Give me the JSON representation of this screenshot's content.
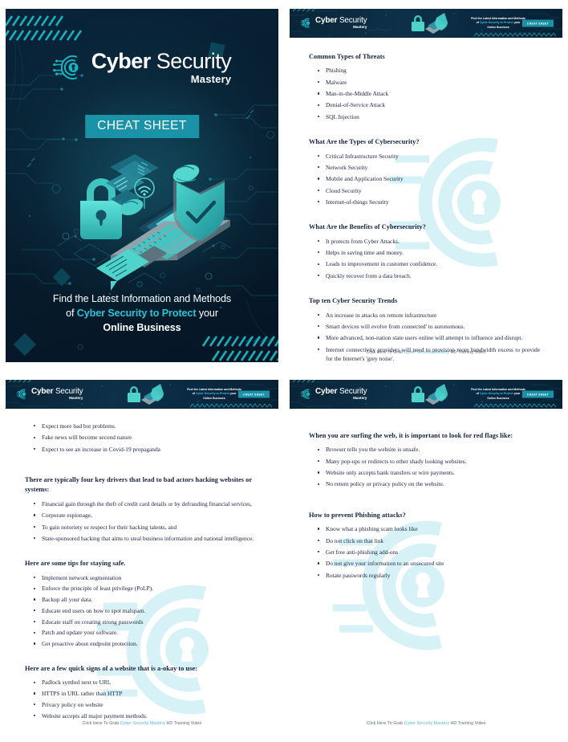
{
  "brand": {
    "name_bold": "Cyber",
    "name_light": " Security",
    "subtitle": "Mastery",
    "badge": "CHEAT SHEET",
    "accent_color": "#1a93a8",
    "highlight_color": "#25c6d8"
  },
  "cover": {
    "badge": "CHEAT SHEET",
    "tagline_line1": "Find the Latest Information and Methods",
    "tagline_line2_pre": "of ",
    "tagline_line2_hl": "Cyber Security to Protect",
    "tagline_line2_post": " your",
    "tagline_line3": "Online Business"
  },
  "header": {
    "tagline_line1": "Find the Latest Information and Methods",
    "tagline_line2_pre": "of ",
    "tagline_line2_hl": "Cyber Security to Protect",
    "tagline_line2_post": " your",
    "tagline_line3": "Online Business",
    "badge": "CHEAT SHEET"
  },
  "footer": {
    "pre": "Click Here To Grab ",
    "link": "Cyber Security Mastery",
    "post": " HD Training Video"
  },
  "page2": {
    "s1_heading": "Common Types of Threats",
    "s1_items": [
      "Phishing",
      "Malware",
      "Man-in-the-Middle Attack",
      "Denial-of-Service Attack",
      "SQL Injection"
    ],
    "s2_heading": "What Are the Types of Cybersecurity?",
    "s2_items": [
      "Critical Infrastructure Security",
      "Network Security",
      "Mobile and Application Security",
      "Cloud Security",
      "Internet-of-things Security"
    ],
    "s3_heading": "What Are the Benefits of Cybersecurity?",
    "s3_items": [
      "It protects from Cyber Attacks.",
      "Helps in saving time and money.",
      "Leads to improvement in customer confidence.",
      "Quickly recover from a data breach."
    ],
    "s4_heading": "Top ten Cyber Security Trends",
    "s4_items": [
      "An increase in attacks on remote infrastructure",
      "Smart devices will evolve from connected' to autonomous.",
      "More advanced, non-nation state users online will attempt to influence and disrupt.",
      "Internet connectivity providers will need to provision more bandwidth excess to provide for the Internet's 'grey noise'."
    ]
  },
  "page3": {
    "s0_items": [
      "Expect more bad bot problems.",
      "Fake news will become second nature",
      "Expect to see an increase in Covid-19 propaganda"
    ],
    "s1_heading": "There are typically four key drivers that lead to bad actors hacking websites or systems:",
    "s1_items": [
      "Financial gain through the theft of credit card details or by defrauding financial services,",
      "Corporate espionage,",
      "To gain notoriety or respect for their hacking talents, and",
      "State-sponsored hacking that aims to steal business information and national intelligence."
    ],
    "s2_heading": "Here are some tips for staying safe.",
    "s2_items": [
      "Implement network segmentation",
      "Enforce the principle of least privilege (PoLP).",
      "Backup all your data.",
      "Educate end users on how to spot malspam.",
      "Educate staff on creating strong passwords",
      "Patch and update your software.",
      "Get proactive about endpoint protection."
    ],
    "s3_heading": "Here are a few quick signs of a website that is a-okay to use:",
    "s3_items": [
      "Padlock symbol next to URL",
      "HTTPS in URL rather than HTTP",
      "Privacy policy on website",
      "Website accepts all major payment methods."
    ]
  },
  "page4": {
    "s1_heading": "When you are surfing the web, it is important to look for red flags like:",
    "s1_items": [
      "Browser tells you the website is unsafe.",
      "Many pop-ups or redirects to other shady looking websites.",
      "Website only accepts bank transfers or wire payments.",
      "No return policy or privacy policy on the website."
    ],
    "s2_heading": "How to prevent Phishing attacks?",
    "s2_items": [
      "Know what a phishing scam looks like",
      "Do not click on that link",
      "Get free anti-phishing add-ons",
      "Do not give your information to an unsecured site",
      "Rotate passwords regularly"
    ]
  }
}
